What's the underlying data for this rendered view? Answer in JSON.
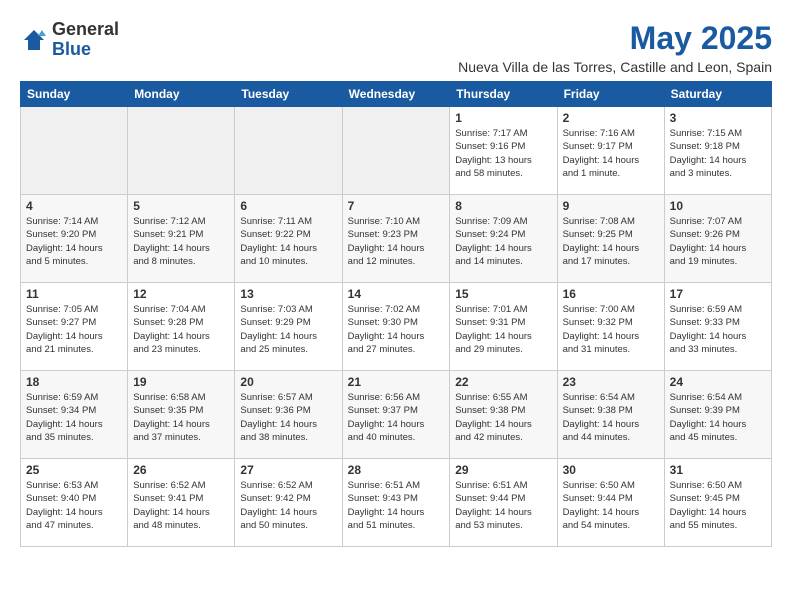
{
  "logo": {
    "general": "General",
    "blue": "Blue"
  },
  "title": "May 2025",
  "location": "Nueva Villa de las Torres, Castille and Leon, Spain",
  "days_of_week": [
    "Sunday",
    "Monday",
    "Tuesday",
    "Wednesday",
    "Thursday",
    "Friday",
    "Saturday"
  ],
  "weeks": [
    [
      {
        "day": "",
        "info": ""
      },
      {
        "day": "",
        "info": ""
      },
      {
        "day": "",
        "info": ""
      },
      {
        "day": "",
        "info": ""
      },
      {
        "day": "1",
        "info": "Sunrise: 7:17 AM\nSunset: 9:16 PM\nDaylight: 13 hours\nand 58 minutes."
      },
      {
        "day": "2",
        "info": "Sunrise: 7:16 AM\nSunset: 9:17 PM\nDaylight: 14 hours\nand 1 minute."
      },
      {
        "day": "3",
        "info": "Sunrise: 7:15 AM\nSunset: 9:18 PM\nDaylight: 14 hours\nand 3 minutes."
      }
    ],
    [
      {
        "day": "4",
        "info": "Sunrise: 7:14 AM\nSunset: 9:20 PM\nDaylight: 14 hours\nand 5 minutes."
      },
      {
        "day": "5",
        "info": "Sunrise: 7:12 AM\nSunset: 9:21 PM\nDaylight: 14 hours\nand 8 minutes."
      },
      {
        "day": "6",
        "info": "Sunrise: 7:11 AM\nSunset: 9:22 PM\nDaylight: 14 hours\nand 10 minutes."
      },
      {
        "day": "7",
        "info": "Sunrise: 7:10 AM\nSunset: 9:23 PM\nDaylight: 14 hours\nand 12 minutes."
      },
      {
        "day": "8",
        "info": "Sunrise: 7:09 AM\nSunset: 9:24 PM\nDaylight: 14 hours\nand 14 minutes."
      },
      {
        "day": "9",
        "info": "Sunrise: 7:08 AM\nSunset: 9:25 PM\nDaylight: 14 hours\nand 17 minutes."
      },
      {
        "day": "10",
        "info": "Sunrise: 7:07 AM\nSunset: 9:26 PM\nDaylight: 14 hours\nand 19 minutes."
      }
    ],
    [
      {
        "day": "11",
        "info": "Sunrise: 7:05 AM\nSunset: 9:27 PM\nDaylight: 14 hours\nand 21 minutes."
      },
      {
        "day": "12",
        "info": "Sunrise: 7:04 AM\nSunset: 9:28 PM\nDaylight: 14 hours\nand 23 minutes."
      },
      {
        "day": "13",
        "info": "Sunrise: 7:03 AM\nSunset: 9:29 PM\nDaylight: 14 hours\nand 25 minutes."
      },
      {
        "day": "14",
        "info": "Sunrise: 7:02 AM\nSunset: 9:30 PM\nDaylight: 14 hours\nand 27 minutes."
      },
      {
        "day": "15",
        "info": "Sunrise: 7:01 AM\nSunset: 9:31 PM\nDaylight: 14 hours\nand 29 minutes."
      },
      {
        "day": "16",
        "info": "Sunrise: 7:00 AM\nSunset: 9:32 PM\nDaylight: 14 hours\nand 31 minutes."
      },
      {
        "day": "17",
        "info": "Sunrise: 6:59 AM\nSunset: 9:33 PM\nDaylight: 14 hours\nand 33 minutes."
      }
    ],
    [
      {
        "day": "18",
        "info": "Sunrise: 6:59 AM\nSunset: 9:34 PM\nDaylight: 14 hours\nand 35 minutes."
      },
      {
        "day": "19",
        "info": "Sunrise: 6:58 AM\nSunset: 9:35 PM\nDaylight: 14 hours\nand 37 minutes."
      },
      {
        "day": "20",
        "info": "Sunrise: 6:57 AM\nSunset: 9:36 PM\nDaylight: 14 hours\nand 38 minutes."
      },
      {
        "day": "21",
        "info": "Sunrise: 6:56 AM\nSunset: 9:37 PM\nDaylight: 14 hours\nand 40 minutes."
      },
      {
        "day": "22",
        "info": "Sunrise: 6:55 AM\nSunset: 9:38 PM\nDaylight: 14 hours\nand 42 minutes."
      },
      {
        "day": "23",
        "info": "Sunrise: 6:54 AM\nSunset: 9:38 PM\nDaylight: 14 hours\nand 44 minutes."
      },
      {
        "day": "24",
        "info": "Sunrise: 6:54 AM\nSunset: 9:39 PM\nDaylight: 14 hours\nand 45 minutes."
      }
    ],
    [
      {
        "day": "25",
        "info": "Sunrise: 6:53 AM\nSunset: 9:40 PM\nDaylight: 14 hours\nand 47 minutes."
      },
      {
        "day": "26",
        "info": "Sunrise: 6:52 AM\nSunset: 9:41 PM\nDaylight: 14 hours\nand 48 minutes."
      },
      {
        "day": "27",
        "info": "Sunrise: 6:52 AM\nSunset: 9:42 PM\nDaylight: 14 hours\nand 50 minutes."
      },
      {
        "day": "28",
        "info": "Sunrise: 6:51 AM\nSunset: 9:43 PM\nDaylight: 14 hours\nand 51 minutes."
      },
      {
        "day": "29",
        "info": "Sunrise: 6:51 AM\nSunset: 9:44 PM\nDaylight: 14 hours\nand 53 minutes."
      },
      {
        "day": "30",
        "info": "Sunrise: 6:50 AM\nSunset: 9:44 PM\nDaylight: 14 hours\nand 54 minutes."
      },
      {
        "day": "31",
        "info": "Sunrise: 6:50 AM\nSunset: 9:45 PM\nDaylight: 14 hours\nand 55 minutes."
      }
    ]
  ]
}
